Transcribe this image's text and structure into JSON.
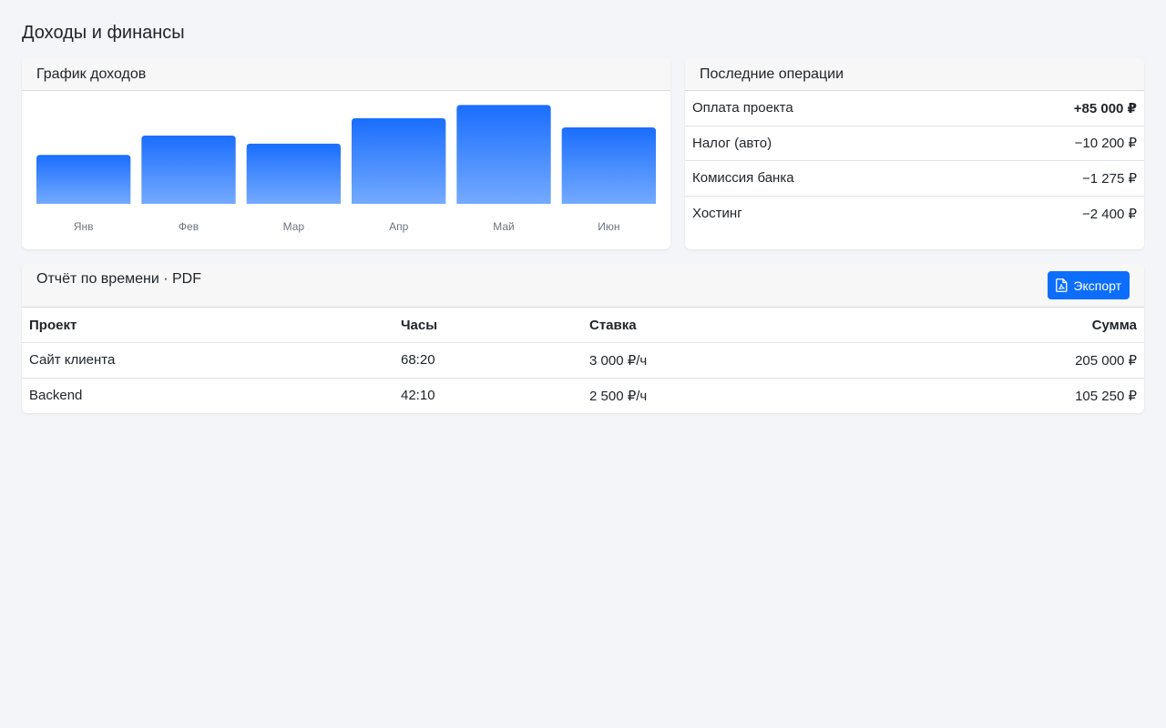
{
  "page": {
    "title": "Доходы и финансы"
  },
  "income_chart": {
    "title": "График доходов",
    "color_top": "#1a6efd",
    "color_bottom": "#74aaff"
  },
  "chart_data": {
    "type": "bar",
    "categories": [
      "Янв",
      "Фев",
      "Мар",
      "Апр",
      "Май",
      "Июн"
    ],
    "values": [
      48,
      67,
      59,
      84,
      97,
      75
    ],
    "title": "График доходов",
    "xlabel": "",
    "ylabel": "",
    "ylim": [
      0,
      100
    ],
    "grid": false,
    "legend": "none"
  },
  "operations": {
    "title": "Последние операции",
    "items": [
      {
        "label": "Оплата проекта",
        "amount": "+85 000 ₽",
        "positive": true
      },
      {
        "label": "Налог (авто)",
        "amount": "−10 200 ₽",
        "positive": false
      },
      {
        "label": "Комиссия банка",
        "amount": "−1 275 ₽",
        "positive": false
      },
      {
        "label": "Хостинг",
        "amount": "−2 400 ₽",
        "positive": false
      }
    ]
  },
  "report": {
    "title": "Отчёт по времени · PDF",
    "export_label": "Экспорт",
    "export_icon": "pdf-file-icon",
    "columns": {
      "project": "Проект",
      "hours": "Часы",
      "rate": "Ставка",
      "sum": "Сумма"
    },
    "rows": [
      {
        "project": "Сайт клиента",
        "hours": "68:20",
        "rate": "3 000 ₽/ч",
        "sum": "205 000 ₽"
      },
      {
        "project": "Backend",
        "hours": "42:10",
        "rate": "2 500 ₽/ч",
        "sum": "105 250 ₽"
      }
    ]
  }
}
